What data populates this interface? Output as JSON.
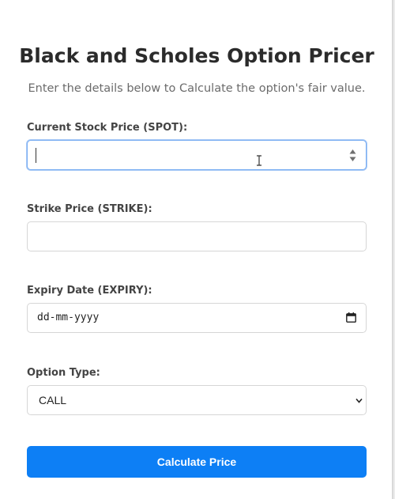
{
  "header": {
    "title": "Black and Scholes Option Pricer",
    "subtitle": "Enter the details below to Calculate the option's fair value."
  },
  "form": {
    "spot": {
      "label": "Current Stock Price (SPOT):",
      "value": ""
    },
    "strike": {
      "label": "Strike Price (STRIKE):",
      "value": ""
    },
    "expiry": {
      "label": "Expiry Date (EXPIRY):",
      "placeholder": "dd-mm-yyyy"
    },
    "option_type": {
      "label": "Option Type:",
      "selected": "CALL"
    },
    "submit_label": "Calculate Price"
  },
  "colors": {
    "accent": "#0d7ff5",
    "focus_border": "#7aaef3"
  },
  "icons": [
    "spinner-arrows-icon",
    "text-cursor-icon",
    "calendar-icon",
    "chevron-down-icon"
  ]
}
